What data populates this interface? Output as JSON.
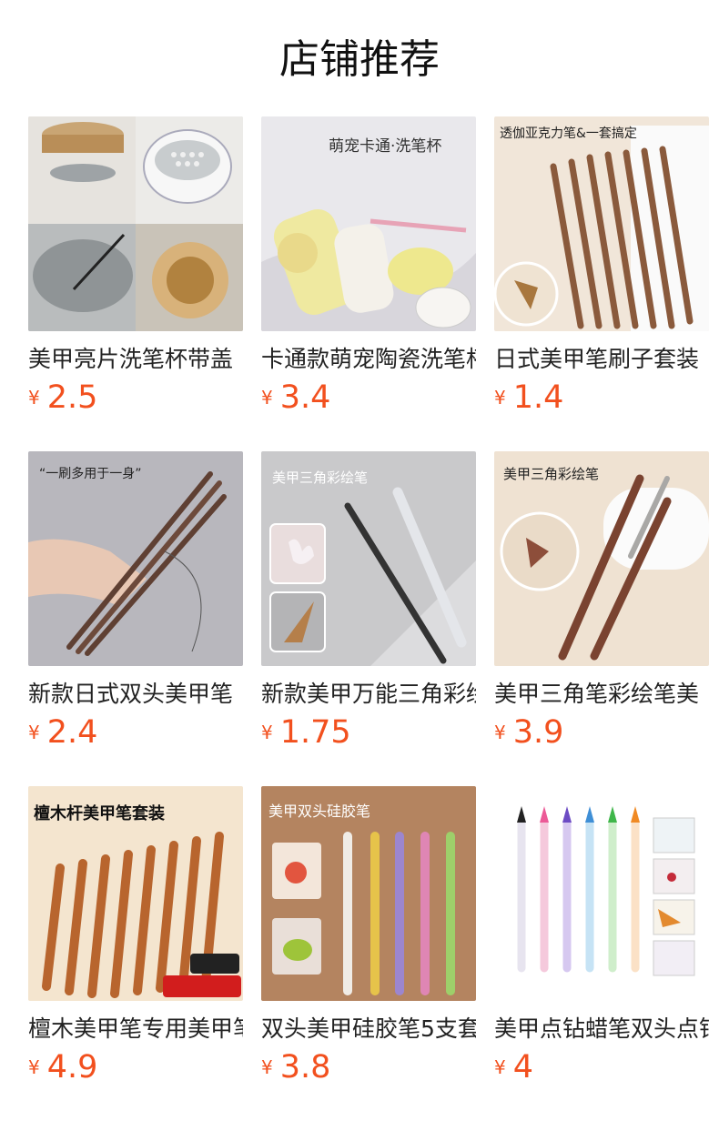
{
  "section_title": "店铺推荐",
  "currency_symbol": "¥",
  "products": [
    {
      "name": "美甲亮片洗笔杯带盖",
      "price": "2.5",
      "image_caption": ""
    },
    {
      "name": "卡通款萌宠陶瓷洗笔杯",
      "price": "3.4",
      "image_caption": "萌宠卡通·洗笔杯"
    },
    {
      "name": "日式美甲笔刷子套装",
      "price": "1.4",
      "image_caption": "透伽亚克力笔&一套搞定"
    },
    {
      "name": "新款日式双头美甲笔",
      "price": "2.4",
      "image_caption": "“一刷多用于一身”"
    },
    {
      "name": "新款美甲万能三角彩绘笔",
      "price": "1.75",
      "image_caption": "美甲三角彩绘笔"
    },
    {
      "name": "美甲三角笔彩绘笔美",
      "price": "3.9",
      "image_caption": "美甲三角彩绘笔"
    },
    {
      "name": "檀木美甲笔专用美甲笔",
      "price": "4.9",
      "image_caption": "檀木杆美甲笔套装"
    },
    {
      "name": "双头美甲硅胶笔5支套",
      "price": "3.8",
      "image_caption": "美甲双头硅胶笔"
    },
    {
      "name": "美甲点钻蜡笔双头点钻笔",
      "price": "4",
      "image_caption": ""
    }
  ]
}
